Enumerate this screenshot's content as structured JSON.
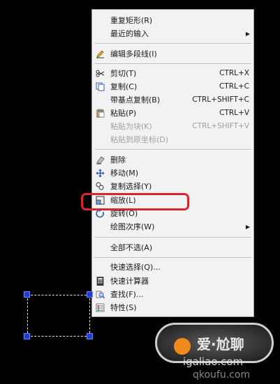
{
  "context_menu": {
    "items": [
      {
        "label": "重复矩形(R)"
      },
      {
        "label": "最近的输入",
        "submenu": true
      },
      {
        "label": "编辑多段线(I)",
        "icon": "pencil-icon"
      },
      {
        "label": "剪切(T)",
        "shortcut": "CTRL+X",
        "icon": "scissors-icon"
      },
      {
        "label": "复制(C)",
        "shortcut": "CTRL+C",
        "icon": "copy-icon"
      },
      {
        "label": "带基点复制(B)",
        "shortcut": "CTRL+SHIFT+C"
      },
      {
        "label": "粘贴(P)",
        "shortcut": "CTRL+V",
        "icon": "paste-icon"
      },
      {
        "label": "粘贴为块(K)",
        "shortcut": "CTRL+SHIFT+V",
        "disabled": true
      },
      {
        "label": "粘贴到原坐标(D)",
        "disabled": true
      },
      {
        "label": "删除",
        "icon": "eraser-icon"
      },
      {
        "label": "移动(M)",
        "icon": "move-icon"
      },
      {
        "label": "复制选择(Y)",
        "icon": "copy-select-icon"
      },
      {
        "label": "缩放(L)",
        "icon": "scale-icon",
        "highlighted": true
      },
      {
        "label": "旋转(O)",
        "icon": "rotate-icon"
      },
      {
        "label": "绘图次序(W)",
        "submenu": true
      },
      {
        "label": "全部不选(A)"
      },
      {
        "label": "快速选择(Q)..."
      },
      {
        "label": "快速计算器",
        "icon": "calculator-icon"
      },
      {
        "label": "查找(F)...",
        "icon": "find-icon"
      },
      {
        "label": "特性(S)",
        "icon": "properties-icon"
      }
    ]
  },
  "watermark": {
    "brand": "爱·尬聊",
    "url": "igaliao.com",
    "url2": "qkoufu.com"
  }
}
